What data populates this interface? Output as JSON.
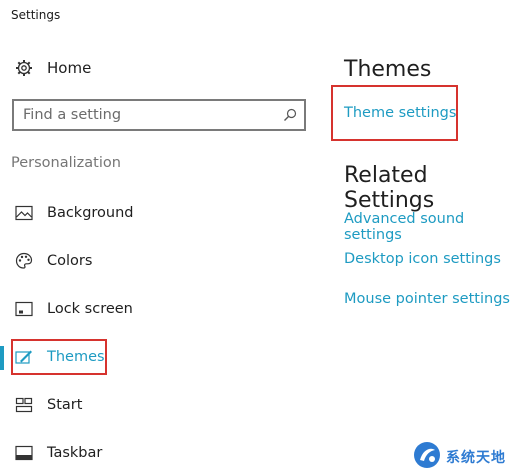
{
  "window": {
    "title": "Settings"
  },
  "home": {
    "label": "Home",
    "icon": "gear-icon"
  },
  "search": {
    "placeholder": "Find a setting",
    "icon": "search-icon"
  },
  "sidebar": {
    "section_label": "Personalization",
    "items": [
      {
        "label": "Background",
        "icon": "background-image-icon"
      },
      {
        "label": "Colors",
        "icon": "palette-icon"
      },
      {
        "label": "Lock screen",
        "icon": "lock-screen-icon"
      },
      {
        "label": "Themes",
        "icon": "themes-brush-icon",
        "active": true
      },
      {
        "label": "Start",
        "icon": "start-tiles-icon"
      },
      {
        "label": "Taskbar",
        "icon": "taskbar-icon"
      }
    ]
  },
  "main": {
    "themes_heading": "Themes",
    "theme_settings_link": "Theme settings",
    "related_heading": "Related Settings",
    "related_links": [
      "Advanced sound settings",
      "Desktop icon settings",
      "Mouse pointer settings"
    ]
  },
  "colors": {
    "accent": "#1e9bc2",
    "highlight": "#d6332e",
    "text": "#1f1f1f",
    "muted": "#767676"
  },
  "watermark": {
    "text": "系统天地"
  }
}
